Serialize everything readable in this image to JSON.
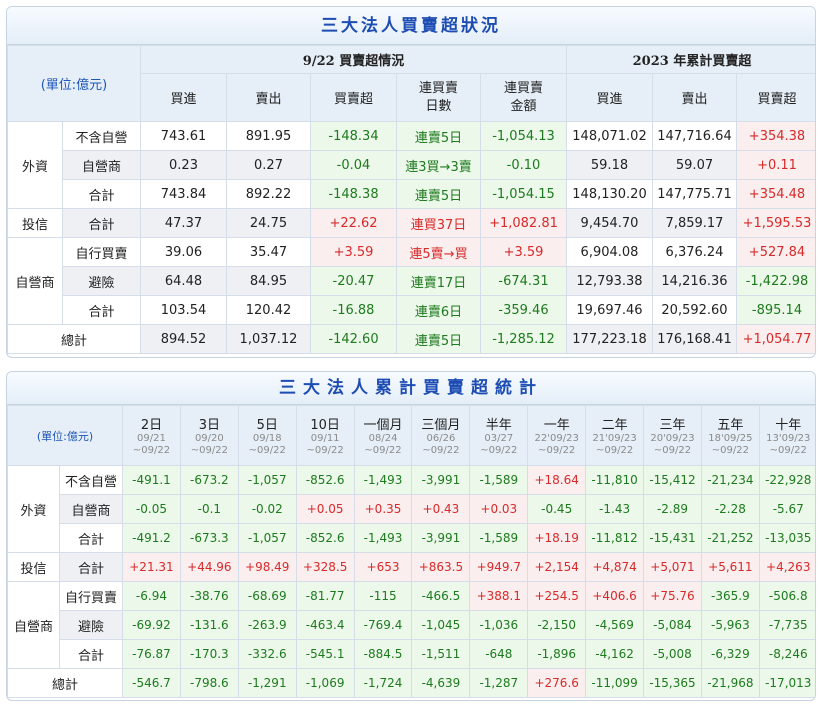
{
  "daily": {
    "title": "三大法人買賣超狀況",
    "unit": "(單位:億元)",
    "group_date": "9/22 買賣超情況",
    "group_year": "2023 年累計買賣超",
    "col_buy": "買進",
    "col_sell": "賣出",
    "col_net": "買賣超",
    "col_days": "連買賣\n日數",
    "col_amount": "連買賣\n金額",
    "cat_foreign": "外資",
    "cat_trust": "投信",
    "cat_dealer": "自營商",
    "total_label": "總計",
    "rows": [
      {
        "sub": "不含自營",
        "buy": "743.61",
        "sell": "891.95",
        "net": "-148.34",
        "streak": "連賣5日",
        "amount": "-1,054.13",
        "y_buy": "148,071.02",
        "y_sell": "147,716.64",
        "y_net": "+354.38"
      },
      {
        "sub": "自營商",
        "buy": "0.23",
        "sell": "0.27",
        "net": "-0.04",
        "streak": "連3買→3賣",
        "amount": "-0.10",
        "y_buy": "59.18",
        "y_sell": "59.07",
        "y_net": "+0.11"
      },
      {
        "sub": "合計",
        "buy": "743.84",
        "sell": "892.22",
        "net": "-148.38",
        "streak": "連賣5日",
        "amount": "-1,054.15",
        "y_buy": "148,130.20",
        "y_sell": "147,775.71",
        "y_net": "+354.48"
      },
      {
        "sub": "合計",
        "buy": "47.37",
        "sell": "24.75",
        "net": "+22.62",
        "streak": "連買37日",
        "amount": "+1,082.81",
        "y_buy": "9,454.70",
        "y_sell": "7,859.17",
        "y_net": "+1,595.53"
      },
      {
        "sub": "自行買賣",
        "buy": "39.06",
        "sell": "35.47",
        "net": "+3.59",
        "streak": "連5賣→買",
        "amount": "+3.59",
        "y_buy": "6,904.08",
        "y_sell": "6,376.24",
        "y_net": "+527.84"
      },
      {
        "sub": "避險",
        "buy": "64.48",
        "sell": "84.95",
        "net": "-20.47",
        "streak": "連賣17日",
        "amount": "-674.31",
        "y_buy": "12,793.38",
        "y_sell": "14,216.36",
        "y_net": "-1,422.98"
      },
      {
        "sub": "合計",
        "buy": "103.54",
        "sell": "120.42",
        "net": "-16.88",
        "streak": "連賣6日",
        "amount": "-359.46",
        "y_buy": "19,697.46",
        "y_sell": "20,592.60",
        "y_net": "-895.14"
      }
    ],
    "total": {
      "buy": "894.52",
      "sell": "1,037.12",
      "net": "-142.60",
      "streak": "連賣5日",
      "amount": "-1,285.12",
      "y_buy": "177,223.18",
      "y_sell": "176,168.41",
      "y_net": "+1,054.77"
    }
  },
  "cumulative": {
    "title": "三大法人累計買賣超統計",
    "unit": "(單位:億元)",
    "periods": [
      {
        "label": "2日",
        "from": "09/21",
        "to": "~09/22"
      },
      {
        "label": "3日",
        "from": "09/20",
        "to": "~09/22"
      },
      {
        "label": "5日",
        "from": "09/18",
        "to": "~09/22"
      },
      {
        "label": "10日",
        "from": "09/11",
        "to": "~09/22"
      },
      {
        "label": "一個月",
        "from": "08/24",
        "to": "~09/22"
      },
      {
        "label": "三個月",
        "from": "06/26",
        "to": "~09/22"
      },
      {
        "label": "半年",
        "from": "03/27",
        "to": "~09/22"
      },
      {
        "label": "一年",
        "from": "22'09/23",
        "to": "~09/22"
      },
      {
        "label": "二年",
        "from": "21'09/23",
        "to": "~09/22"
      },
      {
        "label": "三年",
        "from": "20'09/23",
        "to": "~09/22"
      },
      {
        "label": "五年",
        "from": "18'09/25",
        "to": "~09/22"
      },
      {
        "label": "十年",
        "from": "13'09/23",
        "to": "~09/22"
      }
    ],
    "cat_foreign": "外資",
    "cat_trust": "投信",
    "cat_dealer": "自營商",
    "total_label": "總計",
    "rows": [
      {
        "sub": "不含自營",
        "values": [
          "-491.1",
          "-673.2",
          "-1,057",
          "-852.6",
          "-1,493",
          "-3,991",
          "-1,589",
          "+18.64",
          "-11,810",
          "-15,412",
          "-21,234",
          "-22,928"
        ]
      },
      {
        "sub": "自營商",
        "values": [
          "-0.05",
          "-0.1",
          "-0.02",
          "+0.05",
          "+0.35",
          "+0.43",
          "+0.03",
          "-0.45",
          "-1.43",
          "-2.89",
          "-2.28",
          "-5.67"
        ]
      },
      {
        "sub": "合計",
        "values": [
          "-491.2",
          "-673.3",
          "-1,057",
          "-852.6",
          "-1,493",
          "-3,991",
          "-1,589",
          "+18.19",
          "-11,812",
          "-15,431",
          "-21,252",
          "-13,035"
        ]
      },
      {
        "sub": "合計",
        "values": [
          "+21.31",
          "+44.96",
          "+98.49",
          "+328.5",
          "+653",
          "+863.5",
          "+949.7",
          "+2,154",
          "+4,874",
          "+5,071",
          "+5,611",
          "+4,263"
        ]
      },
      {
        "sub": "自行買賣",
        "values": [
          "-6.94",
          "-38.76",
          "-68.69",
          "-81.77",
          "-115",
          "-466.5",
          "+388.1",
          "+254.5",
          "+406.6",
          "+75.76",
          "-365.9",
          "-506.8"
        ]
      },
      {
        "sub": "避險",
        "values": [
          "-69.92",
          "-131.6",
          "-263.9",
          "-463.4",
          "-769.4",
          "-1,045",
          "-1,036",
          "-2,150",
          "-4,569",
          "-5,084",
          "-5,963",
          "-7,735"
        ]
      },
      {
        "sub": "合計",
        "values": [
          "-76.87",
          "-170.3",
          "-332.6",
          "-545.1",
          "-884.5",
          "-1,511",
          "-648",
          "-1,896",
          "-4,162",
          "-5,008",
          "-6,329",
          "-8,246"
        ]
      }
    ],
    "total": [
      "-546.7",
      "-798.6",
      "-1,291",
      "-1,069",
      "-1,724",
      "-4,639",
      "-1,287",
      "+276.6",
      "-11,099",
      "-15,365",
      "-21,968",
      "-17,013"
    ]
  }
}
